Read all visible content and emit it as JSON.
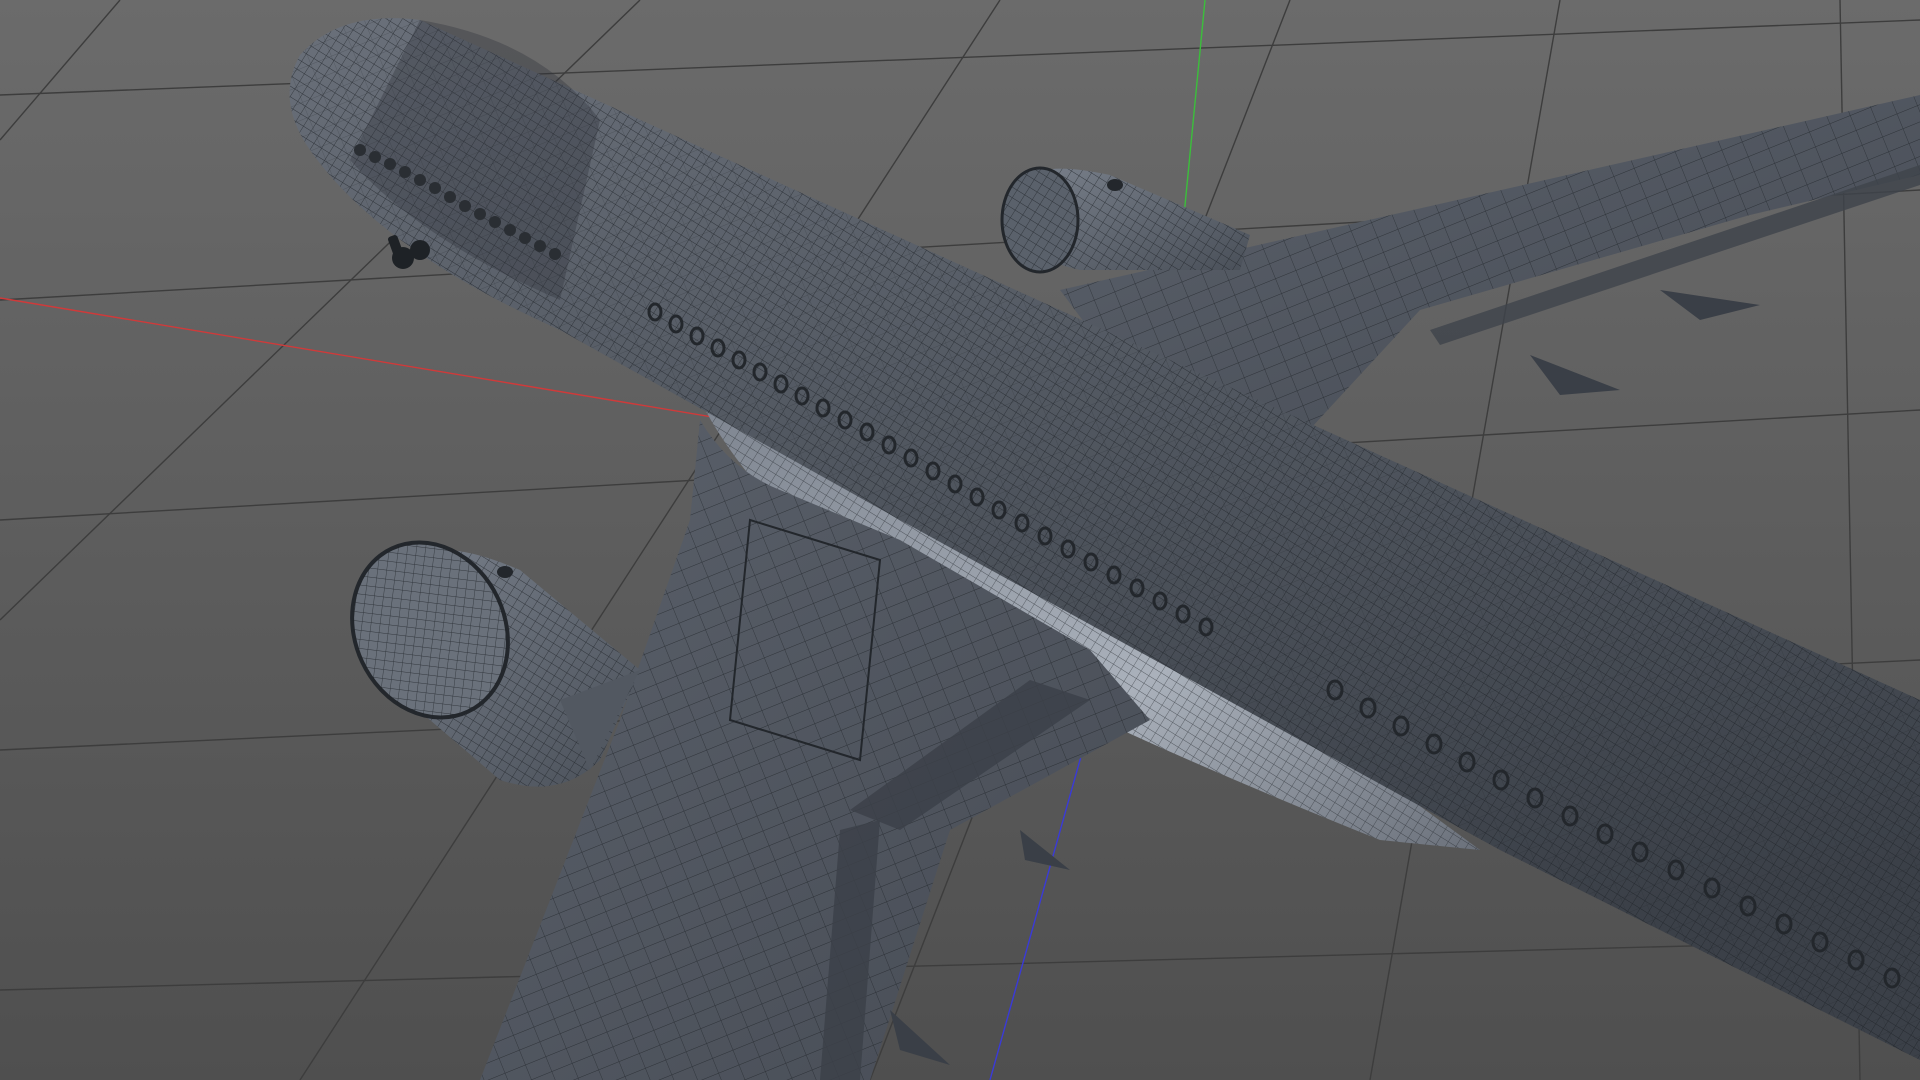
{
  "viewport": {
    "view": "perspective",
    "background_colors": [
      "#6b6b6b",
      "#4f4f4f"
    ],
    "grid": true,
    "grid_color": "#3d3d3d",
    "axis_colors": {
      "x": "#d03a3a",
      "y": "#3bbf3b",
      "z": "#3a3ad8"
    },
    "shading": "gouraud-with-wireframe",
    "mesh_color": "#4a5058",
    "wire_color": "#1f2328"
  },
  "model": {
    "type": "airliner",
    "parts": [
      "fuselage",
      "left-wing",
      "right-wing",
      "left-engine",
      "right-engine",
      "nose-gear"
    ]
  }
}
